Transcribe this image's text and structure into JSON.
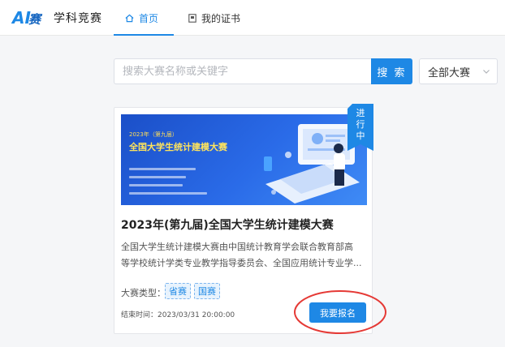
{
  "header": {
    "logo_text": "AI赛",
    "brand": "学科竞赛",
    "nav": [
      {
        "label": "首页",
        "icon": "home-icon",
        "active": true
      },
      {
        "label": "我的证书",
        "icon": "certificate-icon",
        "active": false
      }
    ]
  },
  "search": {
    "placeholder": "搜索大赛名称或关键字",
    "button_label": "搜 索",
    "filter_selected": "全部大赛"
  },
  "competition_card": {
    "status_badge": "进行中",
    "status_chars": [
      "进",
      "行",
      "中"
    ],
    "banner": {
      "year_text": "2023年（第九届）",
      "title_text": "全国大学生统计建模大赛"
    },
    "title": "2023年(第九届)全国大学生统计建模大赛",
    "description_line1": "全国大学生统计建模大赛由中国统计教育学会联合教育部高",
    "description_line2": "等学校统计学类专业教学指导委员会、全国应用统计专业学...",
    "type_label": "大赛类型：",
    "tags": [
      "省赛",
      "国赛"
    ],
    "end_time": "结束时间：2023/03/31 20:00:00",
    "apply_button": "我要报名"
  },
  "colors": {
    "accent": "#1e88e5",
    "annotation": "#e53935",
    "badge_yellow": "#ffe45c"
  }
}
